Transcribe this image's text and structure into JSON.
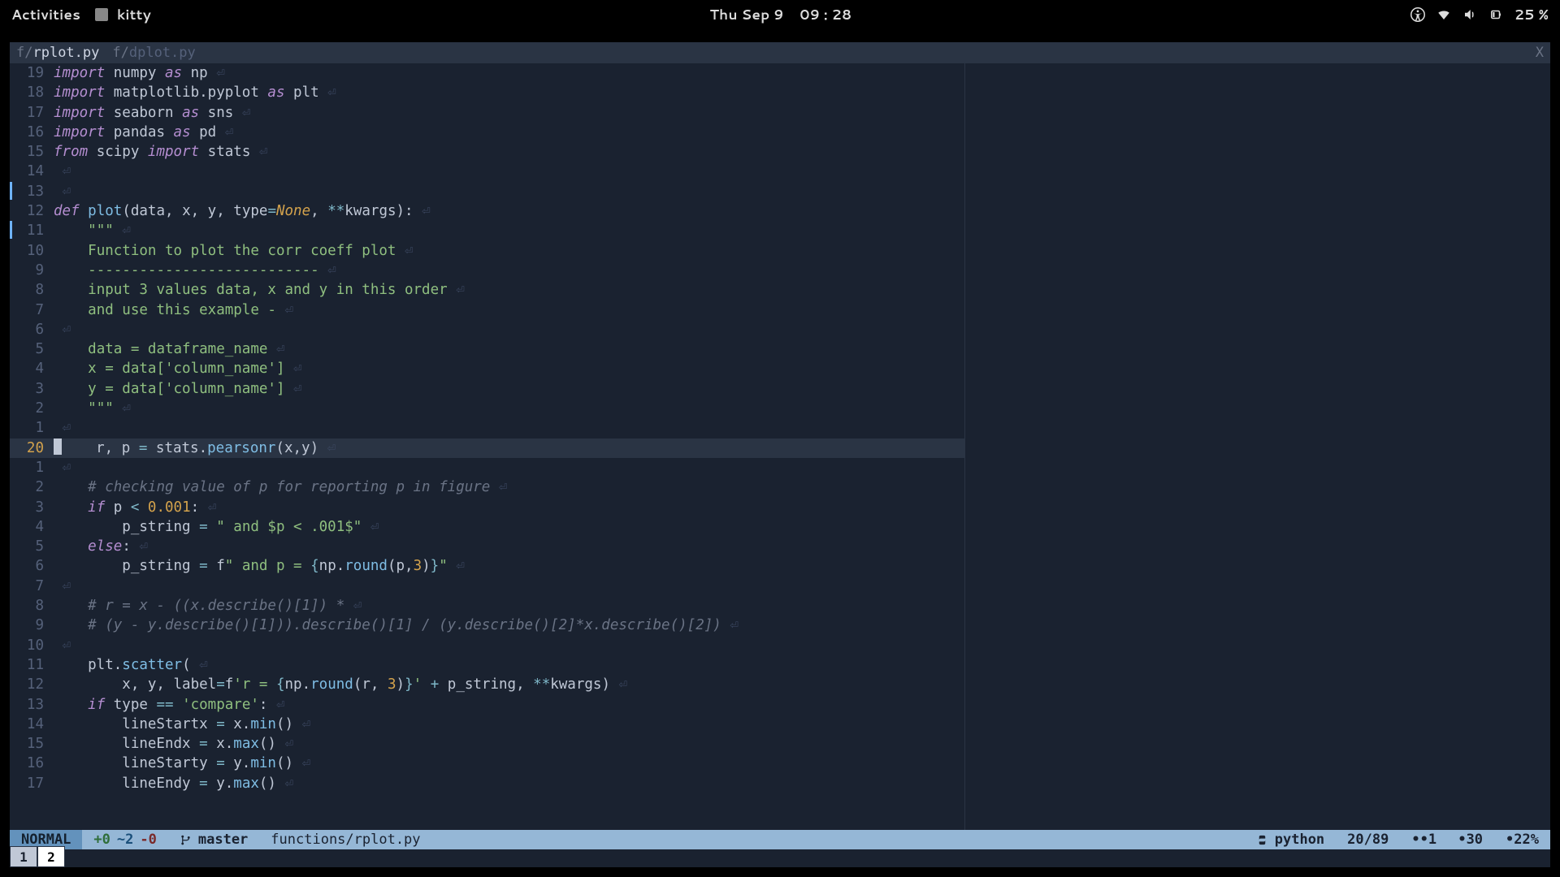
{
  "topbar": {
    "activities": "Activities",
    "app_name": "kitty",
    "clock_day": "Thu Sep 9",
    "clock_time": "09 : 28",
    "battery": "25 %"
  },
  "tabs": {
    "active_prefix": "f/",
    "active_name": "rplot.py",
    "inactive_prefix": "f/",
    "inactive_name": "dplot.py",
    "close": "X"
  },
  "gutter_marks": [
    6,
    8
  ],
  "cursor_row_index": 19,
  "lines": [
    {
      "n": "19",
      "t": [
        [
          "kw",
          "import "
        ],
        [
          "module",
          "numpy "
        ],
        [
          "kw",
          "as "
        ],
        [
          "id",
          "np"
        ]
      ]
    },
    {
      "n": "18",
      "t": [
        [
          "kw",
          "import "
        ],
        [
          "module",
          "matplotlib.pyplot "
        ],
        [
          "kw",
          "as "
        ],
        [
          "id",
          "plt"
        ]
      ]
    },
    {
      "n": "17",
      "t": [
        [
          "kw",
          "import "
        ],
        [
          "module",
          "seaborn "
        ],
        [
          "kw",
          "as "
        ],
        [
          "id",
          "sns"
        ]
      ]
    },
    {
      "n": "16",
      "t": [
        [
          "kw",
          "import "
        ],
        [
          "module",
          "pandas "
        ],
        [
          "kw",
          "as "
        ],
        [
          "id",
          "pd"
        ]
      ]
    },
    {
      "n": "15",
      "t": [
        [
          "kw",
          "from "
        ],
        [
          "module",
          "scipy "
        ],
        [
          "kw",
          "import "
        ],
        [
          "id",
          "stats"
        ]
      ]
    },
    {
      "n": "14",
      "t": []
    },
    {
      "n": "13",
      "t": []
    },
    {
      "n": "12",
      "t": [
        [
          "kw",
          "def "
        ],
        [
          "fn",
          "plot"
        ],
        [
          "id",
          "(data, x, y, type"
        ],
        [
          "op",
          "="
        ],
        [
          "const",
          "None"
        ],
        [
          "id",
          ", "
        ],
        [
          "op",
          "**"
        ],
        [
          "id",
          "kwargs):"
        ]
      ]
    },
    {
      "n": "11",
      "t": [
        [
          "id",
          "    "
        ],
        [
          "str",
          "\"\"\""
        ]
      ]
    },
    {
      "n": "10",
      "t": [
        [
          "id",
          "    "
        ],
        [
          "str",
          "Function to plot the corr coeff plot"
        ]
      ]
    },
    {
      "n": "9",
      "t": [
        [
          "id",
          "    "
        ],
        [
          "str",
          "---------------------------"
        ]
      ]
    },
    {
      "n": "8",
      "t": [
        [
          "id",
          "    "
        ],
        [
          "str",
          "input 3 values data, x and y in this order"
        ]
      ]
    },
    {
      "n": "7",
      "t": [
        [
          "id",
          "    "
        ],
        [
          "str",
          "and use this example -"
        ]
      ]
    },
    {
      "n": "6",
      "t": []
    },
    {
      "n": "5",
      "t": [
        [
          "id",
          "    "
        ],
        [
          "str",
          "data = dataframe_name"
        ]
      ]
    },
    {
      "n": "4",
      "t": [
        [
          "id",
          "    "
        ],
        [
          "str",
          "x = data['column_name']"
        ]
      ]
    },
    {
      "n": "3",
      "t": [
        [
          "id",
          "    "
        ],
        [
          "str",
          "y = data['column_name']"
        ]
      ]
    },
    {
      "n": "2",
      "t": [
        [
          "id",
          "    "
        ],
        [
          "str",
          "\"\"\""
        ]
      ]
    },
    {
      "n": "1",
      "t": []
    },
    {
      "n": "20",
      "t": [
        [
          "id",
          "    r, p "
        ],
        [
          "op",
          "="
        ],
        [
          "id",
          " stats."
        ],
        [
          "fn",
          "pearsonr"
        ],
        [
          "id",
          "(x,y)"
        ]
      ]
    },
    {
      "n": "1",
      "t": []
    },
    {
      "n": "2",
      "t": [
        [
          "id",
          "    "
        ],
        [
          "cm",
          "# checking value of p for reporting p in figure"
        ]
      ]
    },
    {
      "n": "3",
      "t": [
        [
          "id",
          "    "
        ],
        [
          "kw",
          "if "
        ],
        [
          "id",
          "p "
        ],
        [
          "op",
          "< "
        ],
        [
          "num",
          "0.001"
        ],
        [
          "id",
          ":"
        ]
      ]
    },
    {
      "n": "4",
      "t": [
        [
          "id",
          "        p_string "
        ],
        [
          "op",
          "="
        ],
        [
          "id",
          " "
        ],
        [
          "str",
          "\" and $p < .001$\""
        ]
      ]
    },
    {
      "n": "5",
      "t": [
        [
          "id",
          "    "
        ],
        [
          "kw",
          "else"
        ],
        [
          "id",
          ":"
        ]
      ]
    },
    {
      "n": "6",
      "t": [
        [
          "id",
          "        p_string "
        ],
        [
          "op",
          "="
        ],
        [
          "id",
          " f"
        ],
        [
          "str",
          "\" and p = "
        ],
        [
          "op",
          "{"
        ],
        [
          "id",
          "np."
        ],
        [
          "fn",
          "round"
        ],
        [
          "id",
          "(p,"
        ],
        [
          "num",
          "3"
        ],
        [
          "id",
          ")"
        ],
        [
          "op",
          "}"
        ],
        [
          "str",
          "\""
        ]
      ]
    },
    {
      "n": "7",
      "t": []
    },
    {
      "n": "8",
      "t": [
        [
          "id",
          "    "
        ],
        [
          "cm",
          "# r = x - ((x.describe()[1]) *"
        ]
      ]
    },
    {
      "n": "9",
      "t": [
        [
          "id",
          "    "
        ],
        [
          "cm",
          "# (y - y.describe()[1])).describe()[1] / (y.describe()[2]*x.describe()[2])"
        ]
      ]
    },
    {
      "n": "10",
      "t": []
    },
    {
      "n": "11",
      "t": [
        [
          "id",
          "    plt."
        ],
        [
          "fn",
          "scatter"
        ],
        [
          "id",
          "("
        ]
      ]
    },
    {
      "n": "12",
      "t": [
        [
          "id",
          "        x, y, label"
        ],
        [
          "op",
          "="
        ],
        [
          "id",
          "f"
        ],
        [
          "str",
          "'r = "
        ],
        [
          "op",
          "{"
        ],
        [
          "id",
          "np."
        ],
        [
          "fn",
          "round"
        ],
        [
          "id",
          "(r, "
        ],
        [
          "num",
          "3"
        ],
        [
          "id",
          ")"
        ],
        [
          "op",
          "}"
        ],
        [
          "str",
          "'"
        ],
        [
          "id",
          " "
        ],
        [
          "op",
          "+"
        ],
        [
          "id",
          " p_string, "
        ],
        [
          "op",
          "**"
        ],
        [
          "id",
          "kwargs)"
        ]
      ]
    },
    {
      "n": "13",
      "t": [
        [
          "id",
          "    "
        ],
        [
          "kw",
          "if "
        ],
        [
          "id",
          "type "
        ],
        [
          "op",
          "=="
        ],
        [
          "id",
          " "
        ],
        [
          "str",
          "'compare'"
        ],
        [
          "id",
          ":"
        ]
      ]
    },
    {
      "n": "14",
      "t": [
        [
          "id",
          "        lineStartx "
        ],
        [
          "op",
          "="
        ],
        [
          "id",
          " x."
        ],
        [
          "fn",
          "min"
        ],
        [
          "id",
          "()"
        ]
      ]
    },
    {
      "n": "15",
      "t": [
        [
          "id",
          "        lineEndx "
        ],
        [
          "op",
          "="
        ],
        [
          "id",
          " x."
        ],
        [
          "fn",
          "max"
        ],
        [
          "id",
          "()"
        ]
      ]
    },
    {
      "n": "16",
      "t": [
        [
          "id",
          "        lineStarty "
        ],
        [
          "op",
          "="
        ],
        [
          "id",
          " y."
        ],
        [
          "fn",
          "min"
        ],
        [
          "id",
          "()"
        ]
      ]
    },
    {
      "n": "17",
      "t": [
        [
          "id",
          "        lineEndy "
        ],
        [
          "op",
          "="
        ],
        [
          "id",
          " y."
        ],
        [
          "fn",
          "max"
        ],
        [
          "id",
          "()"
        ]
      ]
    }
  ],
  "status": {
    "mode": "NORMAL",
    "git_add": "+0",
    "git_mod": "~2",
    "git_del": "-0",
    "branch": "master",
    "path": "functions/rplot.py",
    "lang": "python",
    "pos": "20/89",
    "warn": "••1",
    "info": "•30",
    "percent": "•22%"
  },
  "kitty_tabs": {
    "inactive": "1",
    "active": "2"
  }
}
